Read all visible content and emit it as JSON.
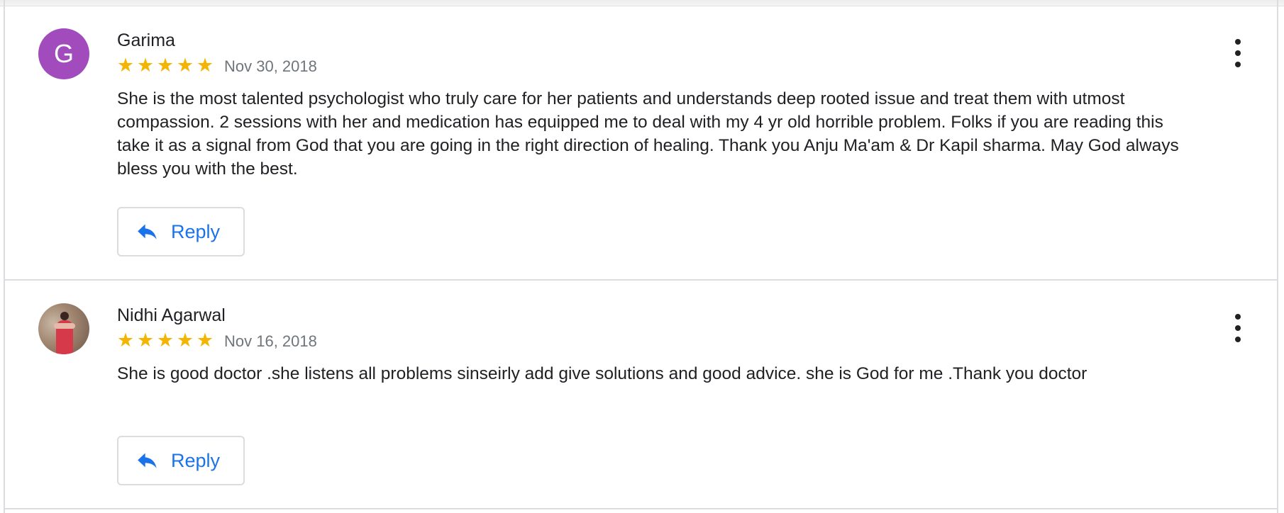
{
  "reviews": [
    {
      "avatar_letter": "G",
      "avatar_color": "#a14bbd",
      "name": "Garima",
      "rating": 5,
      "date": "Nov 30, 2018",
      "text": "She is the most talented psychologist who truly care for her patients and understands deep rooted issue and treat them with utmost compassion. 2 sessions with her and medication has equipped me to deal with my 4 yr old horrible problem. Folks if you are reading this take it as a signal from God that you are going in the right direction of healing. Thank you Anju Ma'am & Dr Kapil sharma. May God always bless you with the best.",
      "reply_label": "Reply"
    },
    {
      "avatar_letter": "",
      "name": "Nidhi Agarwal",
      "rating": 5,
      "date": "Nov 16, 2018",
      "text": "She is good doctor .she listens all problems sinseirly add give solutions and good advice. she is God for me .Thank you doctor",
      "reply_label": "Reply"
    }
  ],
  "icons": {
    "star": "star-icon",
    "reply": "reply-icon",
    "more": "more-vert-icon"
  },
  "colors": {
    "star": "#f4b400",
    "link": "#1a73e8",
    "border": "#dadce0",
    "muted": "#70757a"
  }
}
